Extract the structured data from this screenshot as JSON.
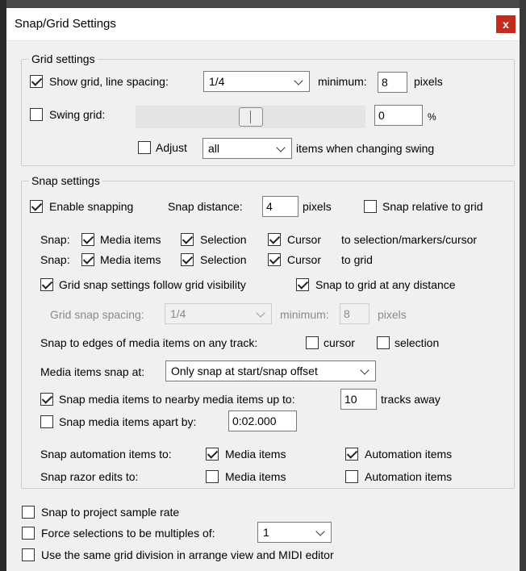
{
  "window": {
    "title": "Snap/Grid Settings",
    "close": "x"
  },
  "grid": {
    "title": "Grid settings",
    "show_grid_label": "Show grid, line spacing:",
    "show_grid_checked": true,
    "line_spacing": "1/4",
    "minimum_label": "minimum:",
    "minimum_value": "8",
    "pixels": "pixels",
    "swing_label": "Swing grid:",
    "swing_checked": false,
    "swing_slider_level": 0.5,
    "swing_value": "0",
    "swing_unit": "%",
    "adjust_label": "Adjust",
    "adjust_checked": false,
    "adjust_select": "all",
    "adjust_suffix": "items when changing swing"
  },
  "snap": {
    "title": "Snap settings",
    "enable_label": "Enable snapping",
    "enable_checked": true,
    "distance_label": "Snap distance:",
    "distance_value": "4",
    "distance_unit": "pixels",
    "relative_label": "Snap relative to grid",
    "relative_checked": false,
    "row1": {
      "prefix": "Snap:",
      "media": "Media items",
      "selection": "Selection",
      "cursor": "Cursor",
      "suffix": "to selection/markers/cursor"
    },
    "row2": {
      "prefix": "Snap:",
      "media": "Media items",
      "selection": "Selection",
      "cursor": "Cursor",
      "suffix": "to grid"
    },
    "follow_visibility_label": "Grid snap settings follow grid visibility",
    "any_distance_label": "Snap to grid at any distance",
    "spacing_label": "Grid snap spacing:",
    "spacing_value": "1/4",
    "spacing_min_label": "minimum:",
    "spacing_min_value": "8",
    "spacing_pixels": "pixels",
    "edges_label": "Snap to edges of media items on any track:",
    "edges_cursor": "cursor",
    "edges_selection": "selection",
    "media_snap_label": "Media items snap at:",
    "media_snap_value": "Only snap at start/snap offset",
    "nearby_label": "Snap media items to nearby media items up to:",
    "nearby_value": "10",
    "nearby_suffix": "tracks away",
    "apart_label": "Snap media items apart by:",
    "apart_value": "0:02.000",
    "automation_label": "Snap automation items to:",
    "automation_media": "Media items",
    "automation_auto": "Automation items",
    "razor_label": "Snap razor edits to:",
    "razor_media": "Media items",
    "razor_auto": "Automation items"
  },
  "bottom": {
    "sample_rate_label": "Snap to project sample rate",
    "force_label": "Force selections to be multiples of:",
    "force_value": "1",
    "same_grid_label": "Use the same grid division in arrange view and MIDI editor"
  }
}
